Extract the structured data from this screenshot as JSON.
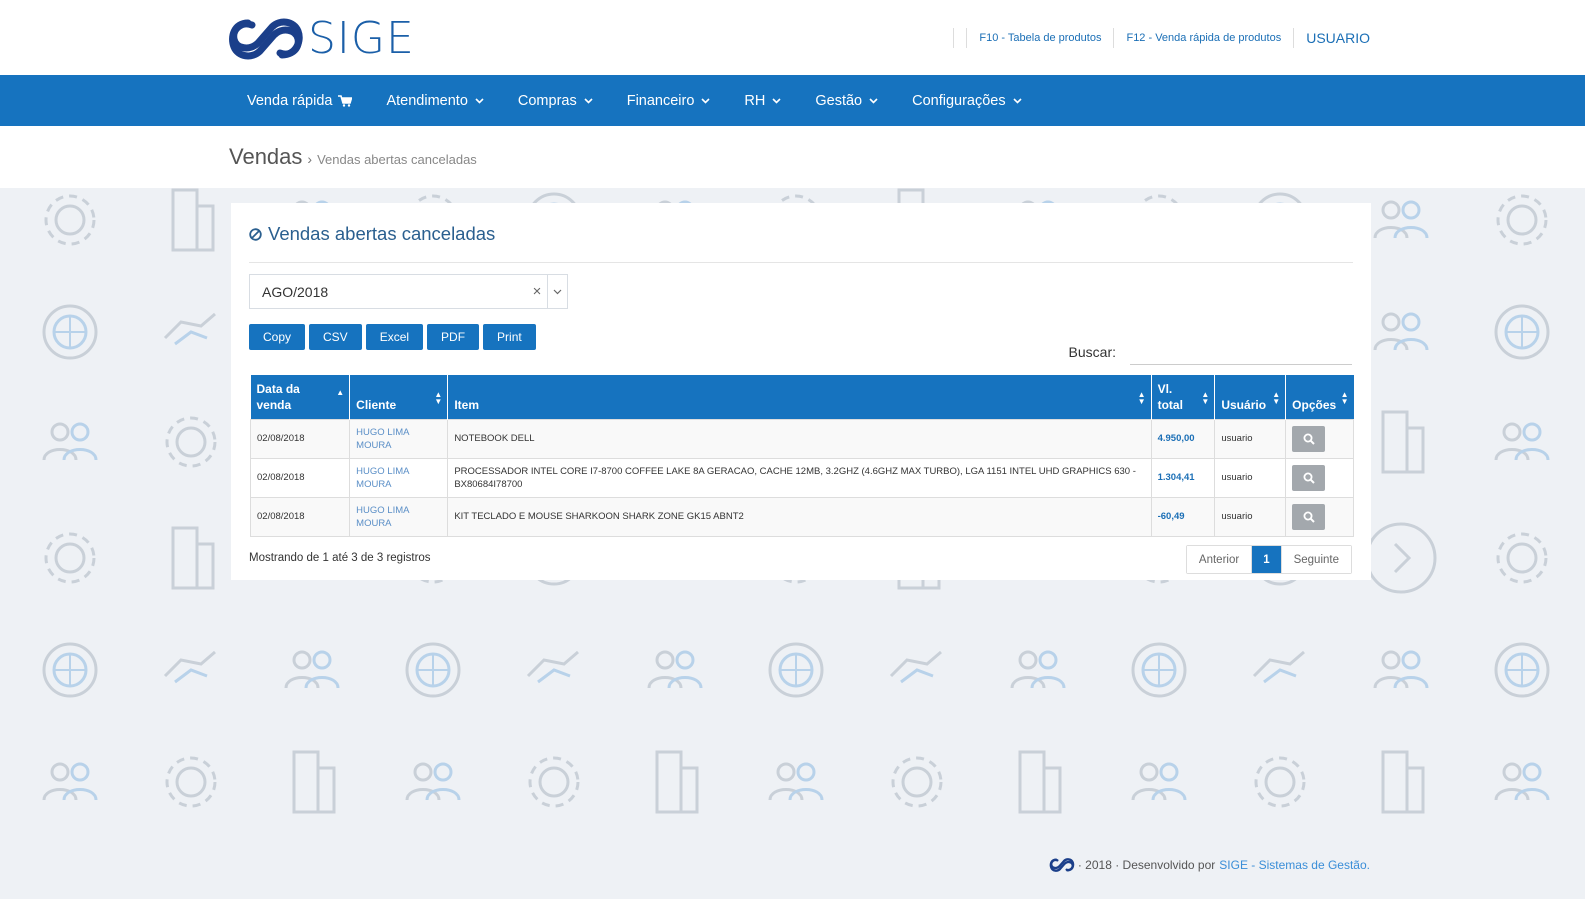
{
  "app": {
    "logo_text": "SIGE"
  },
  "toplinks": {
    "link1": "F10 - Tabela de produtos",
    "link2": "F12 - Venda rápida de produtos",
    "user": "USUARIO"
  },
  "nav": {
    "items": [
      {
        "label": "Venda rápida",
        "icon": "cart-icon"
      },
      {
        "label": "Atendimento",
        "icon": "chevron-down-icon"
      },
      {
        "label": "Compras",
        "icon": "chevron-down-icon"
      },
      {
        "label": "Financeiro",
        "icon": "chevron-down-icon"
      },
      {
        "label": "RH",
        "icon": "chevron-down-icon"
      },
      {
        "label": "Gestão",
        "icon": "chevron-down-icon"
      },
      {
        "label": "Configurações",
        "icon": "chevron-down-icon"
      }
    ]
  },
  "breadcrumb": {
    "main": "Vendas",
    "separator": "›",
    "sub": "Vendas abertas canceladas"
  },
  "panel": {
    "title": "Vendas abertas canceladas",
    "period": {
      "value": "AGO/2018",
      "clear": "×"
    },
    "export_buttons": [
      "Copy",
      "CSV",
      "Excel",
      "PDF",
      "Print"
    ],
    "search_label": "Buscar:",
    "search_value": ""
  },
  "table": {
    "headers": [
      "Data da venda",
      "Cliente",
      "Item",
      "Vl. total",
      "Usuário",
      "Opções"
    ],
    "rows": [
      {
        "data": "02/08/2018",
        "cliente": "HUGO LIMA MOURA",
        "item": "NOTEBOOK DELL",
        "valor": "4.950,00",
        "usuario": "usuario"
      },
      {
        "data": "02/08/2018",
        "cliente": "HUGO LIMA MOURA",
        "item": "PROCESSADOR INTEL CORE I7-8700 COFFEE LAKE 8A GERACAO, CACHE 12MB, 3.2GHZ (4.6GHZ MAX TURBO), LGA 1151 INTEL UHD GRAPHICS 630 - BX80684I78700",
        "valor": "1.304,41",
        "usuario": "usuario"
      },
      {
        "data": "02/08/2018",
        "cliente": "HUGO LIMA MOURA",
        "item": "KIT TECLADO E MOUSE SHARKOON SHARK ZONE GK15 ABNT2",
        "valor": "-60,49",
        "usuario": "usuario"
      }
    ]
  },
  "footer_info": {
    "text": "Mostrando de 1 até 3 de 3 registros"
  },
  "pagination": {
    "prev": "Anterior",
    "current": "1",
    "next": "Seguinte"
  },
  "footer": {
    "year_text": "· 2018 · Desenvolvido por",
    "link": "SIGE - Sistemas de Gestão."
  },
  "colors": {
    "primary": "#1673bf",
    "title": "#2a5f8f",
    "link": "#3a8ed8"
  }
}
